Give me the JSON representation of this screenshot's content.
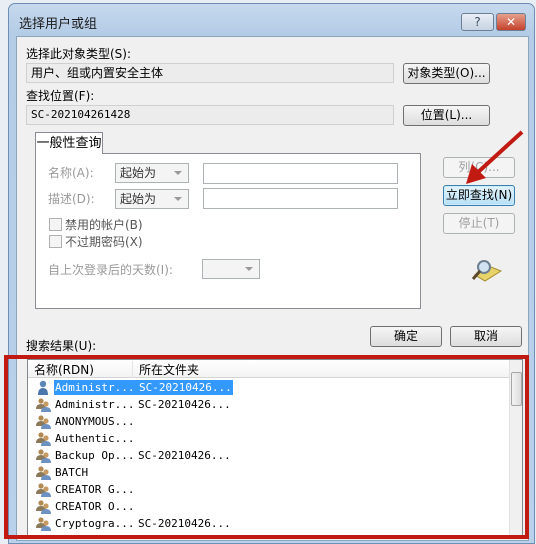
{
  "dialog": {
    "title": "选择用户或组",
    "help_glyph": "?",
    "close_glyph": "✕"
  },
  "object_type": {
    "label": "选择此对象类型(S):",
    "value": "用户、组或内置安全主体",
    "button": "对象类型(O)..."
  },
  "location": {
    "label": "查找位置(F):",
    "value": "SC-202104261428",
    "button": "位置(L)..."
  },
  "query_tab": {
    "label": "一般性查询"
  },
  "query": {
    "name_label": "名称(A):",
    "name_mode": "起始为",
    "name_value": "",
    "desc_label": "描述(D):",
    "desc_mode": "起始为",
    "desc_value": "",
    "disabled_accounts": "禁用的帐户(B)",
    "disabled_checked": false,
    "non_expiring": "不过期密码(X)",
    "non_expiring_checked": false,
    "days_label": "自上次登录后的天数(I):",
    "days_value": ""
  },
  "side_buttons": {
    "columns": "列(C)...",
    "find_now": "立即查找(N)",
    "stop": "停止(T)"
  },
  "results_label": "搜索结果(U):",
  "ok": "确定",
  "cancel": "取消",
  "results": {
    "headers": [
      "名称(RDN)",
      "所在文件夹"
    ],
    "rows": [
      {
        "name": "Administr...",
        "folder": "SC-20210426...",
        "icon": "user-icon",
        "selected": true
      },
      {
        "name": "Administr...",
        "folder": "SC-20210426...",
        "icon": "group-icon"
      },
      {
        "name": "ANONYMOUS...",
        "folder": "",
        "icon": "group-icon"
      },
      {
        "name": "Authentic...",
        "folder": "",
        "icon": "group-icon"
      },
      {
        "name": "Backup Op...",
        "folder": "SC-20210426...",
        "icon": "group-icon"
      },
      {
        "name": "BATCH",
        "folder": "",
        "icon": "group-icon"
      },
      {
        "name": "CREATOR G...",
        "folder": "",
        "icon": "group-icon"
      },
      {
        "name": "CREATOR O...",
        "folder": "",
        "icon": "group-icon"
      },
      {
        "name": "Cryptogra...",
        "folder": "SC-20210426...",
        "icon": "group-icon"
      }
    ]
  },
  "annotation": {
    "highlight_color": "#c11a12"
  }
}
